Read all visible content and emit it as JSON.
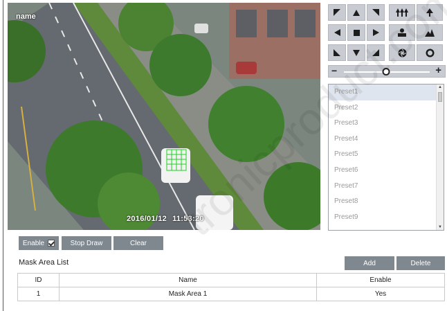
{
  "video": {
    "camera_name": "name",
    "date": "2016/01/12",
    "time": "11:53:20"
  },
  "ptz": {
    "buttons": [
      {
        "name": "ptz-up-left-icon"
      },
      {
        "name": "ptz-up-icon"
      },
      {
        "name": "ptz-up-right-icon"
      },
      {
        "name": "zoom-out-icon"
      },
      {
        "name": "zoom-in-icon"
      },
      {
        "name": "ptz-left-icon"
      },
      {
        "name": "ptz-stop-icon"
      },
      {
        "name": "ptz-right-icon"
      },
      {
        "name": "focus-near-icon"
      },
      {
        "name": "focus-far-icon"
      },
      {
        "name": "ptz-down-left-icon"
      },
      {
        "name": "ptz-down-icon"
      },
      {
        "name": "ptz-down-right-icon"
      },
      {
        "name": "iris-close-icon"
      },
      {
        "name": "iris-open-icon"
      }
    ],
    "speed": {
      "minus": "−",
      "plus": "+",
      "level": 0.49
    }
  },
  "presets": [
    "Preset1",
    "Preset2",
    "Preset3",
    "Preset4",
    "Preset5",
    "Preset6",
    "Preset7",
    "Preset8",
    "Preset9"
  ],
  "toolbar": {
    "enable_label": "Enable",
    "enable_checked": true,
    "stop_draw_label": "Stop Draw",
    "clear_label": "Clear",
    "add_label": "Add",
    "delete_label": "Delete"
  },
  "mask_area_list": {
    "title": "Mask Area List",
    "columns": [
      "ID",
      "Name",
      "Enable"
    ],
    "rows": [
      {
        "id": "1",
        "name": "Mask Area 1",
        "enable": "Yes"
      }
    ]
  },
  "watermark": "tronicproduct.com",
  "colors": {
    "button_gray": "#7f878f",
    "ptz_button": "#c8ccd2",
    "selected_preset": "#dfe5ee",
    "mask_grid": "#1fd11f"
  }
}
